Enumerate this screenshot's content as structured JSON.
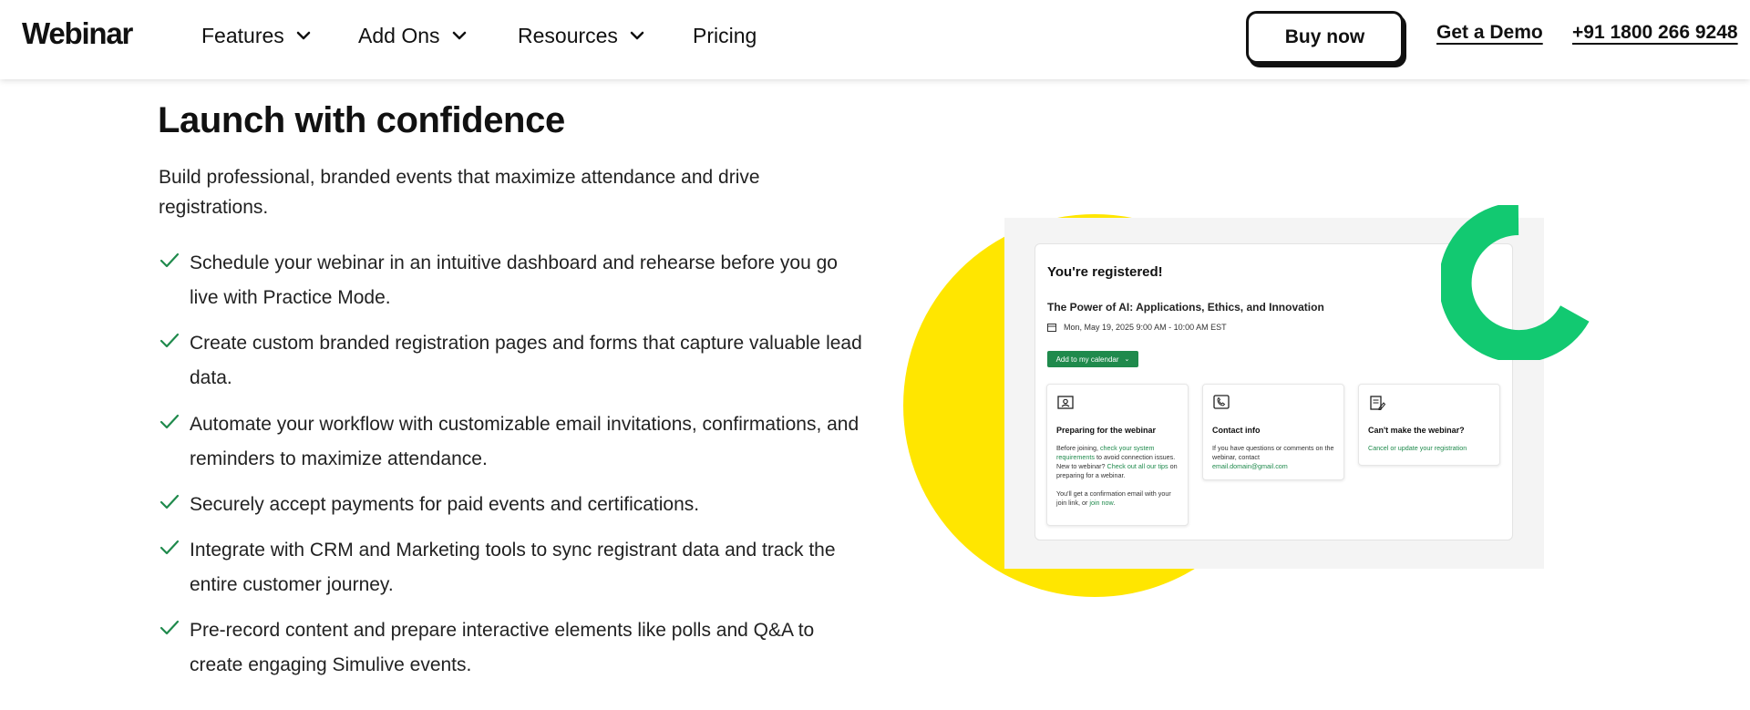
{
  "header": {
    "logo": "Webinar",
    "nav": [
      {
        "label": "Features",
        "has_dropdown": true
      },
      {
        "label": "Add Ons",
        "has_dropdown": true
      },
      {
        "label": "Resources",
        "has_dropdown": true
      },
      {
        "label": "Pricing",
        "has_dropdown": false
      }
    ],
    "buy_now": "Buy now",
    "get_demo": "Get a Demo",
    "phone": "+91 1800 266 9248"
  },
  "main": {
    "headline": "Launch with confidence",
    "intro": "Build professional, branded events that maximize attendance and drive registrations.",
    "features": [
      "Schedule your webinar in an intuitive dashboard and rehearse before you go live with Practice Mode.",
      "Create custom branded registration pages and forms that capture valuable lead data.",
      "Automate your workflow with customizable email invitations, confirmations, and reminders to maximize attendance.",
      "Securely accept payments for paid events and certifications.",
      "Integrate with CRM and Marketing tools to sync registrant data and track the entire customer journey.",
      "Pre-record content and prepare interactive elements like polls and Q&A to create engaging Simulive events."
    ]
  },
  "preview": {
    "title": "You're registered!",
    "event_name": "The Power of AI: Applications, Ethics, and Innovation",
    "date": "Mon, May 19, 2025  9:00 AM - 10:00 AM EST",
    "calendar_button": "Add to my calendar",
    "cards": [
      {
        "title": "Preparing for the webinar",
        "body_1": "Before joining, ",
        "link_1": "check your system requirements",
        "body_2": " to avoid connection issues. New to webinar? ",
        "link_2": "Check out all our tips",
        "body_3": " on preparing for a webinar.",
        "body_4": "You'll get a confirmation email with your join link, or ",
        "link_3": "join now",
        "body_5": "."
      },
      {
        "title": "Contact info",
        "body": "If you have questions or comments on the webinar, contact",
        "link": "email.domain@gmail.com"
      },
      {
        "title": "Can't make the webinar?",
        "link": "Cancel or update your registration"
      }
    ]
  },
  "colors": {
    "accent_green": "#1f8a4c",
    "ring_green": "#12c971",
    "circle_yellow": "#ffe600",
    "check_green": "#1f8a4c"
  }
}
